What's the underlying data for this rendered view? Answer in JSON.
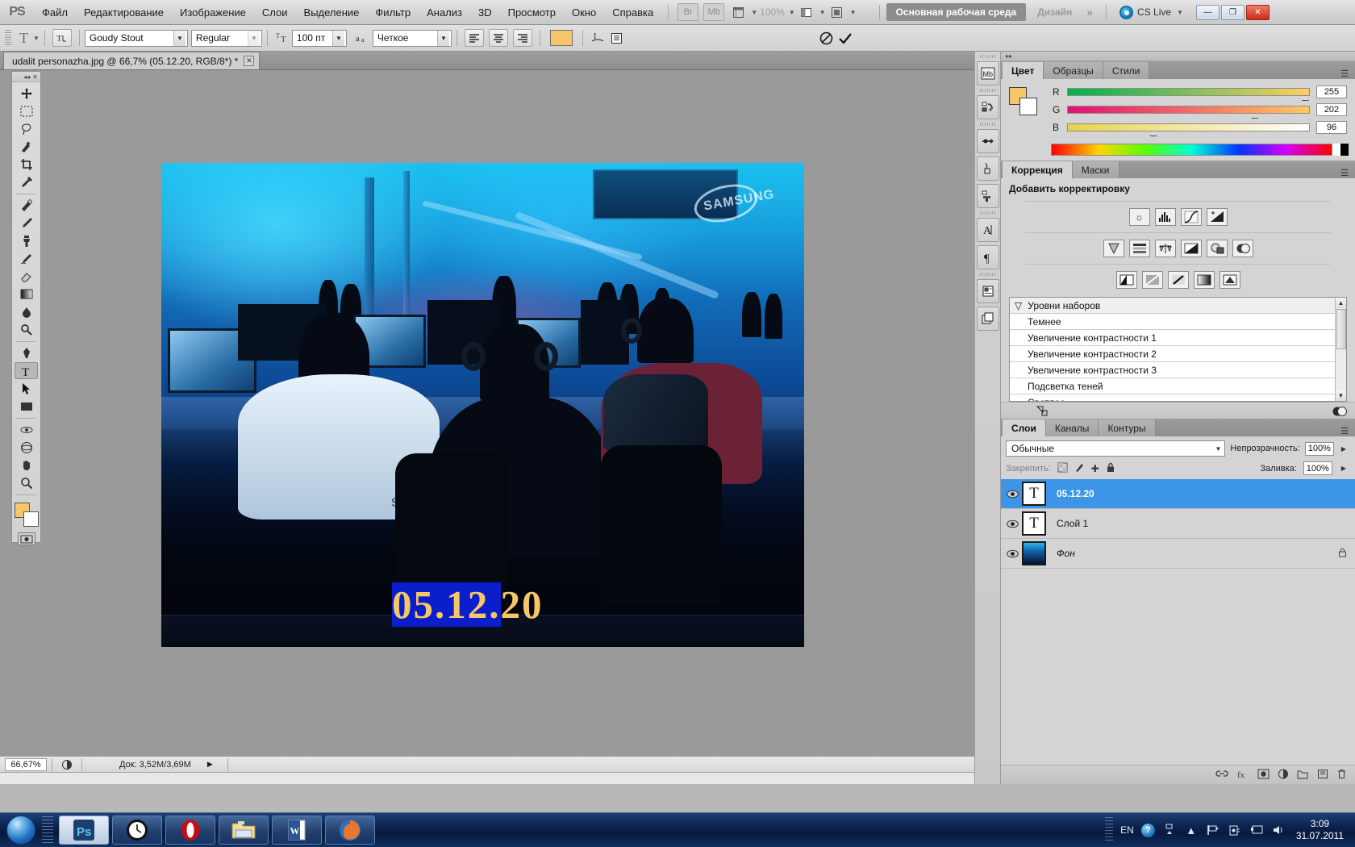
{
  "app": {
    "name": "Adobe Photoshop",
    "logo_text": "PS"
  },
  "menubar": {
    "items": [
      "Файл",
      "Редактирование",
      "Изображение",
      "Слои",
      "Выделение",
      "Фильтр",
      "Анализ",
      "3D",
      "Просмотр",
      "Окно",
      "Справка"
    ],
    "bridge_label": "Br",
    "minibridge_label": "Mb",
    "zoom_value": "100%",
    "workspace_active": "Основная рабочая среда",
    "workspace_other": "Дизайн",
    "workspace_more": "»",
    "cslive_label": "CS Live",
    "window_minimize": "—",
    "window_restore": "❐",
    "window_close": "✕"
  },
  "optionsbar": {
    "tool_icon": "type-tool-icon",
    "orientation_icon": "text-orientation-icon",
    "font_family": "Goudy Stout",
    "font_style": "Regular",
    "font_size": "100 пт",
    "antialias_label": "Четкое",
    "align_left": "align-left-icon",
    "align_center": "align-center-icon",
    "align_right": "align-right-icon",
    "text_color": "#f5c768",
    "warp_icon": "warp-text-icon",
    "panel_icon": "character-panel-icon",
    "cancel_icon": "cancel-icon",
    "commit_icon": "commit-icon"
  },
  "document": {
    "tab_title": "udalit personazha.jpg @ 66,7% (05.12.20, RGB/8*) *",
    "close_label": "✕"
  },
  "toolbox": {
    "tools": [
      {
        "name": "move-tool",
        "glyph": "✛",
        "selected": false
      },
      {
        "name": "marquee-tool",
        "glyph": "⬚",
        "selected": false
      },
      {
        "name": "lasso-tool",
        "glyph": "⊃",
        "selected": false
      },
      {
        "name": "quick-selection-tool",
        "glyph": "✎",
        "selected": false
      },
      {
        "name": "crop-tool",
        "glyph": "⌗",
        "selected": false
      },
      {
        "name": "eyedropper-tool",
        "glyph": "✒",
        "selected": false
      },
      {
        "name": "spot-healing-tool",
        "glyph": "☙",
        "selected": false
      },
      {
        "name": "brush-tool",
        "glyph": "✏",
        "selected": false
      },
      {
        "name": "clone-stamp-tool",
        "glyph": "⚑",
        "selected": false
      },
      {
        "name": "history-brush-tool",
        "glyph": "⟲",
        "selected": false
      },
      {
        "name": "eraser-tool",
        "glyph": "◪",
        "selected": false
      },
      {
        "name": "gradient-tool",
        "glyph": "▤",
        "selected": false
      },
      {
        "name": "blur-tool",
        "glyph": "●",
        "selected": false
      },
      {
        "name": "dodge-tool",
        "glyph": "◑",
        "selected": false
      },
      {
        "name": "pen-tool",
        "glyph": "✑",
        "selected": false
      },
      {
        "name": "type-tool",
        "glyph": "T",
        "selected": true
      },
      {
        "name": "path-selection-tool",
        "glyph": "↖",
        "selected": false
      },
      {
        "name": "shape-tool",
        "glyph": "▭",
        "selected": false
      },
      {
        "name": "3d-rotate-tool",
        "glyph": "⭮",
        "selected": false
      },
      {
        "name": "3d-orbit-tool",
        "glyph": "⦿",
        "selected": false
      },
      {
        "name": "hand-tool",
        "glyph": "✋",
        "selected": false
      },
      {
        "name": "zoom-tool",
        "glyph": "⌕",
        "selected": false
      }
    ],
    "foreground_color": "#f5c768",
    "background_color": "#ffffff"
  },
  "canvas": {
    "image_caption_text": "05.12.20",
    "image_caption_highlight": "05.12.",
    "image_caption_rest": "20",
    "brand_on_shirt": "SAMSUNG",
    "wall_brand": "SAMSUNG"
  },
  "statusbar": {
    "zoom": "66,67%",
    "doc_info": "Док: 3,52M/3,69M",
    "expand_arrow": "▶"
  },
  "dockstrip": {
    "icons": [
      "minibridge-icon",
      "history-icon",
      "adjustments-brush-icon",
      "tool-presets-icon",
      "clone-source-icon",
      "character-icon",
      "paragraph-icon",
      "notes-icon",
      "layer-comps-icon"
    ]
  },
  "color_panel": {
    "tabs": [
      "Цвет",
      "Образцы",
      "Стили"
    ],
    "active_tab": "Цвет",
    "foreground": "#f5c768",
    "background": "#ffffff",
    "channels": [
      {
        "label": "R",
        "value": "255",
        "pos": 100
      },
      {
        "label": "G",
        "value": "202",
        "pos": 79
      },
      {
        "label": "B",
        "value": "96",
        "pos": 37
      }
    ]
  },
  "adjustments_panel": {
    "tabs": [
      "Коррекция",
      "Маски"
    ],
    "active_tab": "Коррекция",
    "title": "Добавить корректировку",
    "row1_icons": [
      "brightness-contrast-icon",
      "levels-icon",
      "curves-icon",
      "exposure-icon"
    ],
    "row2_icons": [
      "vibrance-icon",
      "hue-saturation-icon",
      "color-balance-icon",
      "black-white-icon",
      "photo-filter-icon",
      "channel-mixer-icon"
    ],
    "row3_icons": [
      "invert-icon",
      "posterize-icon",
      "threshold-icon",
      "gradient-map-icon",
      "selective-color-icon"
    ],
    "preset_group": "Уровни наборов",
    "presets": [
      "Темнее",
      "Увеличение контрастности 1",
      "Увеличение контрастности 2",
      "Увеличение контрастности 3",
      "Подсветка теней",
      "Светлее"
    ]
  },
  "layers_panel": {
    "tabs": [
      "Слои",
      "Каналы",
      "Контуры"
    ],
    "active_tab": "Слои",
    "blend_mode": "Обычные",
    "opacity_label": "Непрозрачность:",
    "opacity_value": "100%",
    "lock_label": "Закрепить:",
    "lock_icons": [
      "lock-transparent-icon",
      "lock-image-icon",
      "lock-position-icon",
      "lock-all-icon"
    ],
    "fill_label": "Заливка:",
    "fill_value": "100%",
    "layers": [
      {
        "name": "05.12.20",
        "type": "text",
        "visible": true,
        "selected": true,
        "locked": false,
        "italic": false
      },
      {
        "name": "Слой 1",
        "type": "text",
        "visible": true,
        "selected": false,
        "locked": false,
        "italic": false
      },
      {
        "name": "Фон",
        "type": "image",
        "visible": true,
        "selected": false,
        "locked": true,
        "italic": true
      }
    ],
    "footer_icons": [
      "link-layers-icon",
      "layer-style-icon",
      "layer-mask-icon",
      "new-group-icon",
      "new-adjustment-icon",
      "new-layer-icon",
      "delete-layer-icon"
    ]
  },
  "taskbar": {
    "start_label": "start-orb-icon",
    "apps": [
      {
        "name": "photoshop",
        "label": "Ps",
        "active": true
      },
      {
        "name": "clock-widget",
        "label": "◔",
        "active": false
      },
      {
        "name": "opera",
        "label": "O",
        "active": false
      },
      {
        "name": "explorer",
        "label": "▤",
        "active": false
      },
      {
        "name": "word",
        "label": "W",
        "active": false
      },
      {
        "name": "firefox",
        "label": "◉",
        "active": false
      }
    ],
    "language": "EN",
    "tray_icons": [
      "help-icon",
      "show-hidden-icon",
      "flag-icon",
      "network-icon",
      "display-icon",
      "volume-icon"
    ],
    "clock_time": "3:09",
    "clock_date": "31.07.2011"
  }
}
